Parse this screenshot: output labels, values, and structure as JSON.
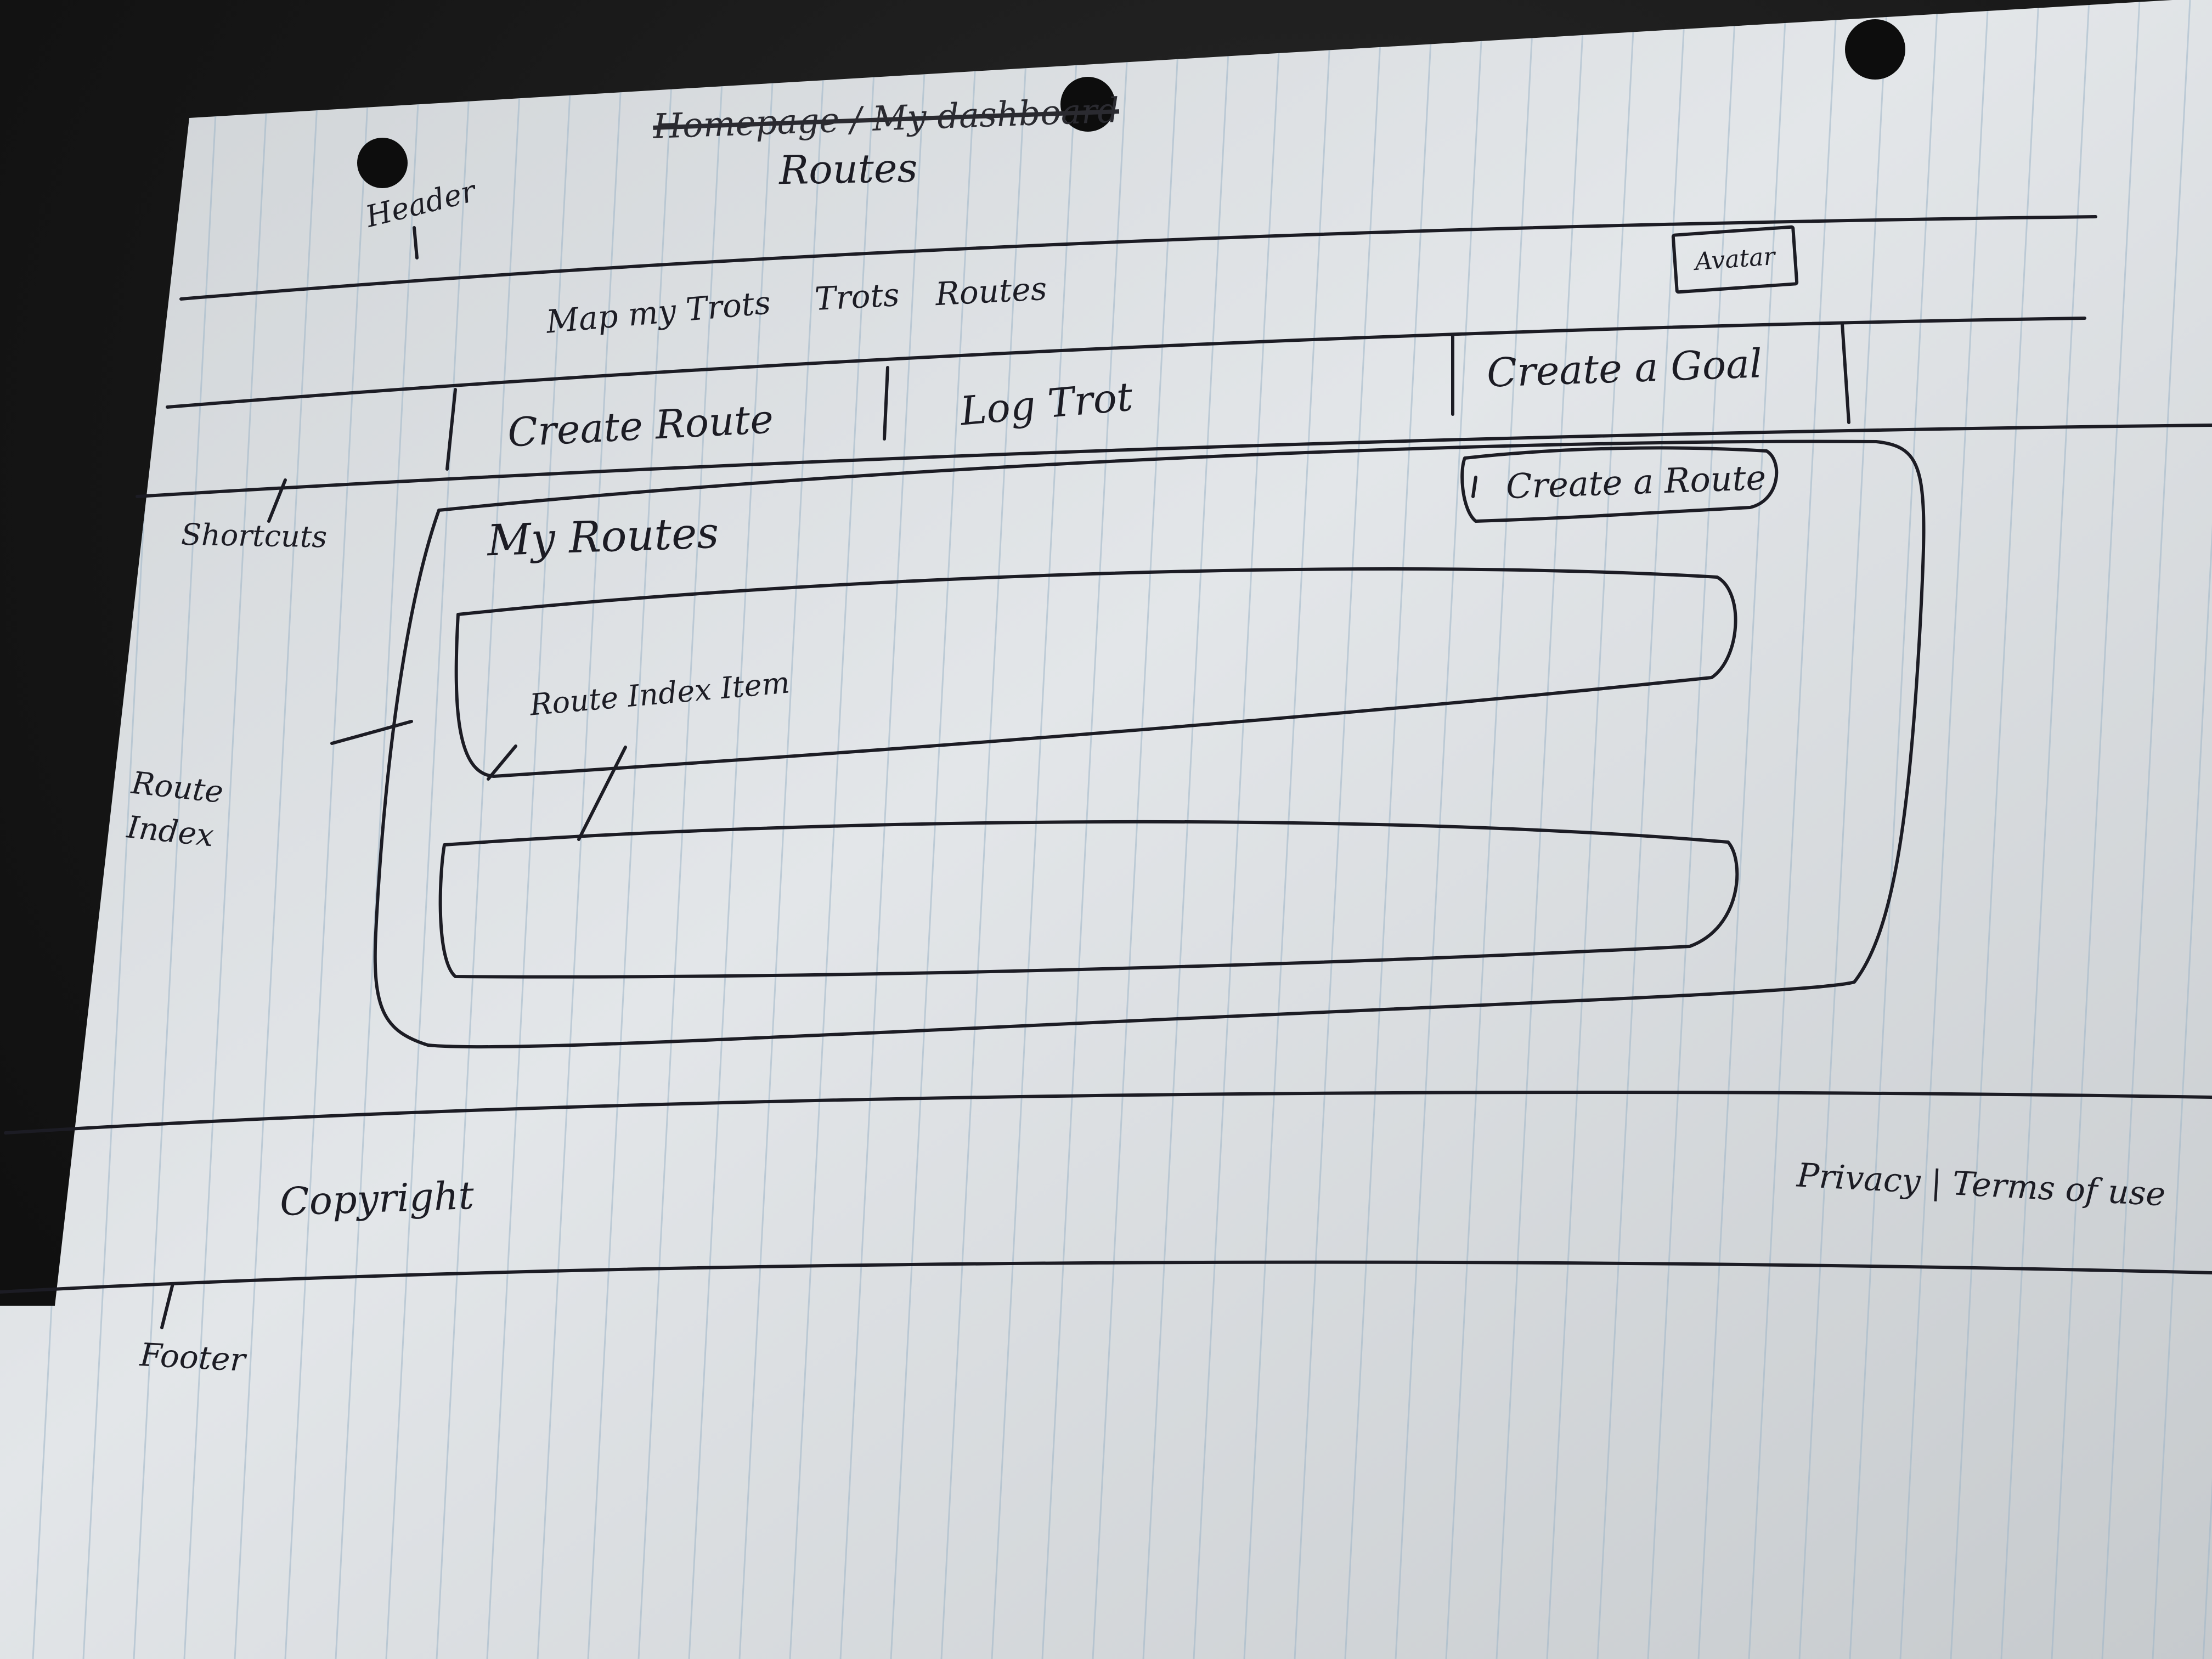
{
  "annotations": {
    "header": "Header",
    "shortcuts": "Shortcuts",
    "route_index": "Route Index",
    "route_index_item": "Route Index Item",
    "footer": "Footer"
  },
  "page": {
    "title_struck": "Homepage / My dashboard",
    "title": "Routes"
  },
  "header": {
    "avatar": "Avatar",
    "nav_items": [
      "Map my Trots",
      "Trots",
      "Routes"
    ]
  },
  "shortcuts": {
    "items": [
      "Create Route",
      "Log Trot",
      "Create a Goal"
    ]
  },
  "main": {
    "create_route_button": "Create a Route",
    "heading": "My Routes"
  },
  "footer": {
    "copyright": "Copyright",
    "links": "Privacy | Terms of use"
  },
  "colors": {
    "paper": "#dfe3e6",
    "rule_lines": "#9fb6c8",
    "ink": "#1c1c24",
    "background": "#121212"
  }
}
